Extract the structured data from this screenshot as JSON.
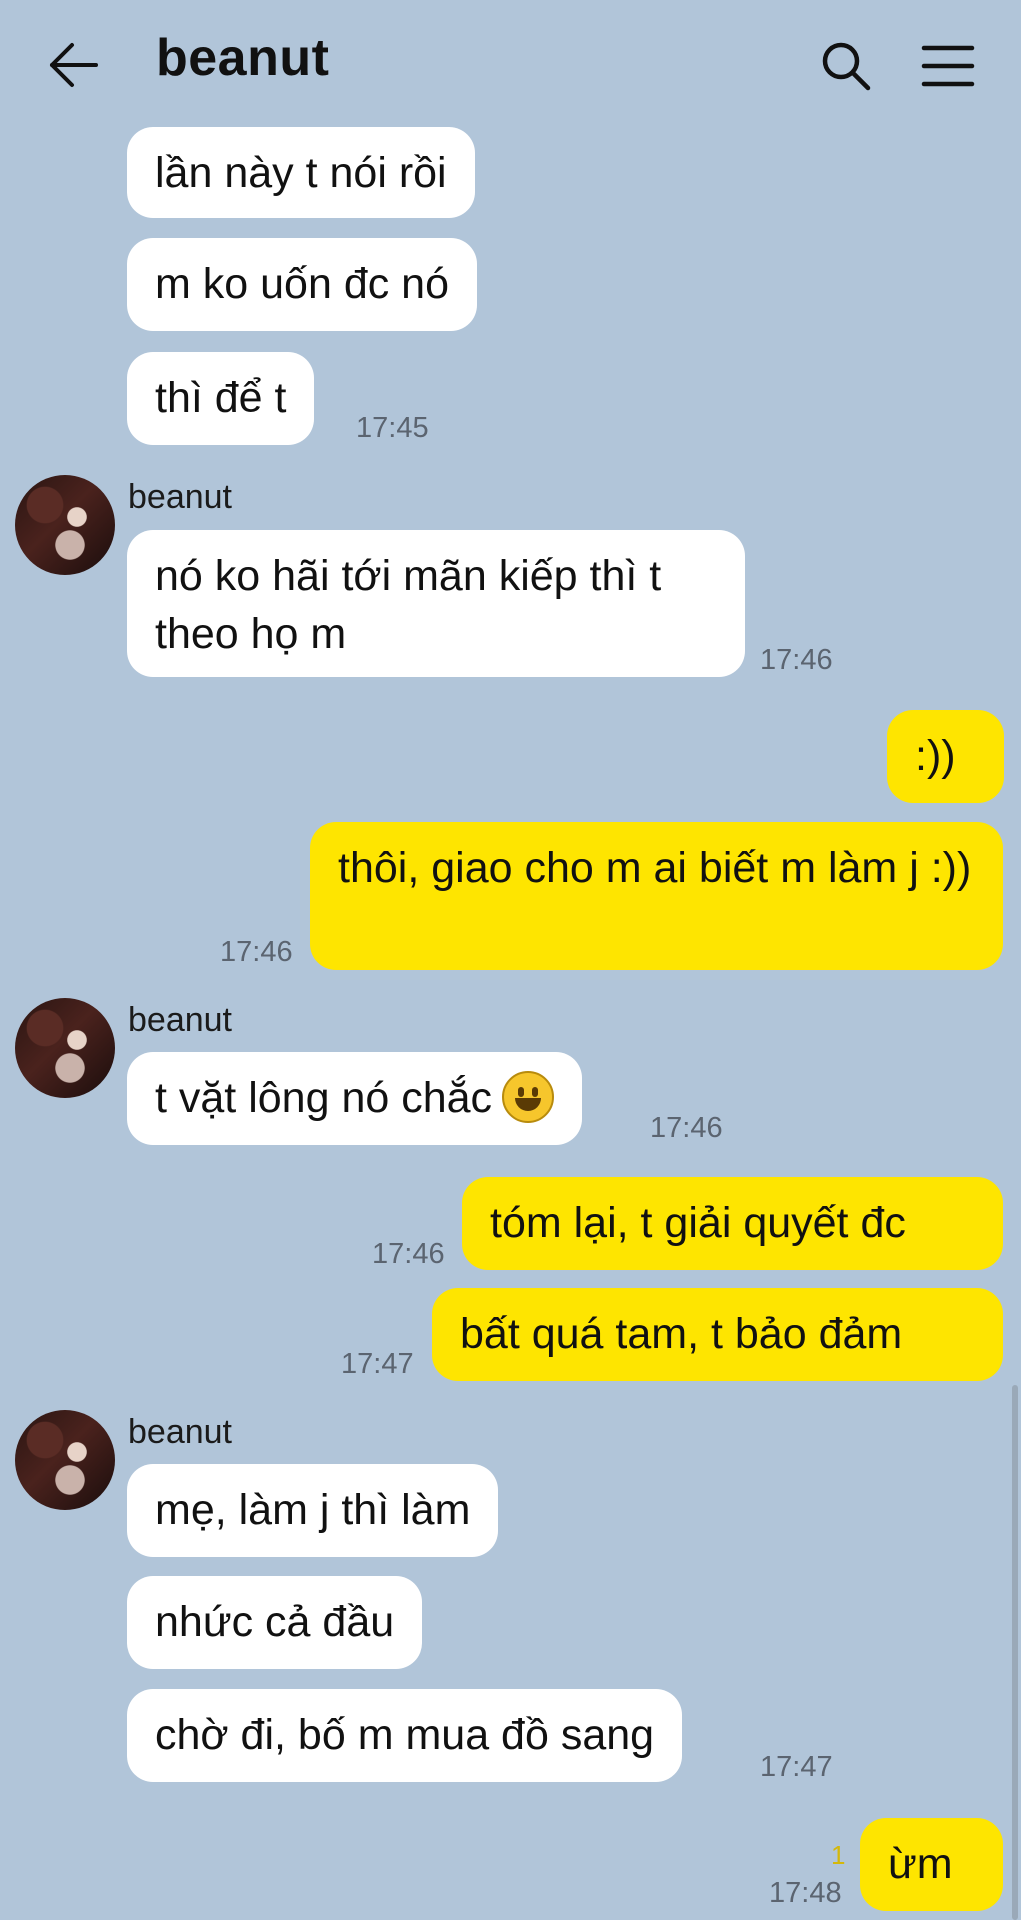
{
  "header": {
    "title": "beanut"
  },
  "messages": [
    {
      "side": "in",
      "text": "lần này t nói rồi"
    },
    {
      "side": "in",
      "text": "m ko uốn đc nó"
    },
    {
      "side": "in",
      "text": "thì để t",
      "time": "17:45"
    },
    {
      "side": "in",
      "sender": "beanut",
      "text": "nó ko hãi tới mãn kiếp thì t theo họ m",
      "time": "17:46"
    },
    {
      "side": "out",
      "text": ":))"
    },
    {
      "side": "out",
      "text": "thôi, giao cho m ai biết m làm j :))",
      "time": "17:46"
    },
    {
      "side": "in",
      "sender": "beanut",
      "text": "t vặt lông nó chắc",
      "emoji": "grinning-face",
      "time": "17:46"
    },
    {
      "side": "out",
      "text": "tóm lại, t giải quyết đc",
      "time": "17:46"
    },
    {
      "side": "out",
      "text": "bất quá tam, t bảo đảm",
      "time": "17:47"
    },
    {
      "side": "in",
      "sender": "beanut",
      "text": "mẹ, làm j thì làm"
    },
    {
      "side": "in",
      "text": "nhức cả đầu"
    },
    {
      "side": "in",
      "text": "chờ đi, bố m mua đồ sang",
      "time": "17:47"
    },
    {
      "side": "out",
      "text": "ừm",
      "time": "17:48",
      "unread": "1"
    }
  ],
  "colors": {
    "background": "#b1c5d9",
    "incoming_bubble": "#ffffff",
    "outgoing_bubble": "#fee500",
    "timestamp": "#5b6470"
  }
}
